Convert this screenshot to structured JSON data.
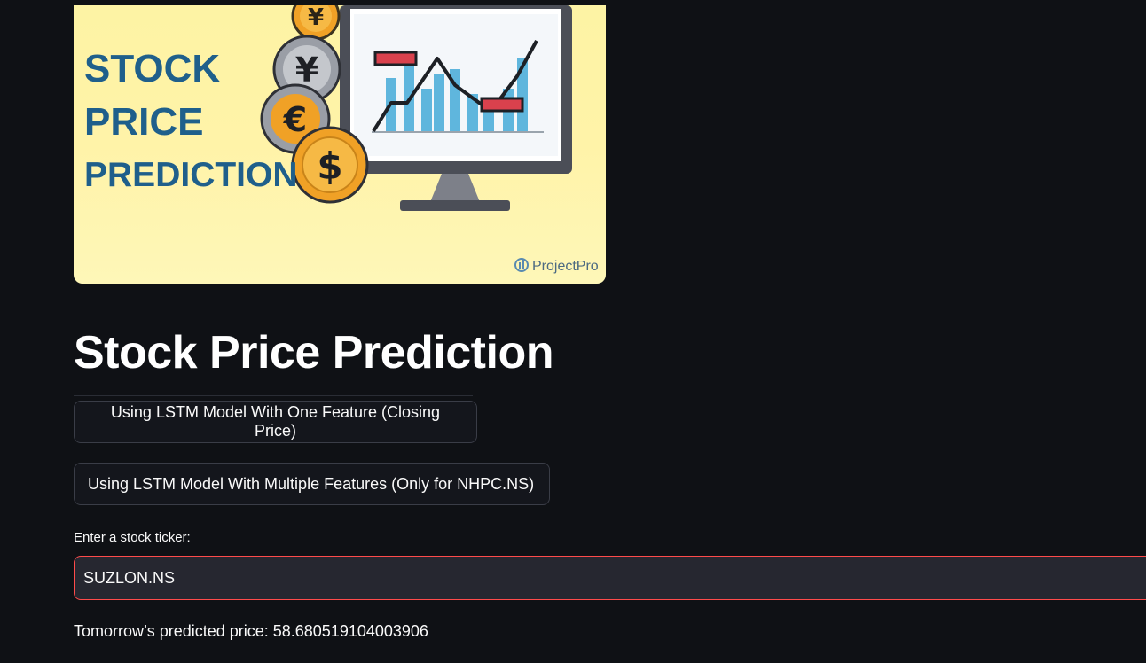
{
  "hero": {
    "headline_lines": [
      "STOCK",
      "PRICE",
      "PREDICTION"
    ],
    "watermark": "ProjectPro",
    "coin_symbols": [
      "¥",
      "€",
      "$"
    ],
    "colors": {
      "background": "#fdf3a4",
      "headline": "#1f5f8b",
      "coin_gold": "#f0a126",
      "coin_silver": "#9a9ea6",
      "monitor": "#4b4e57",
      "bars": "#5fb6dd",
      "marker": "#d9414d"
    }
  },
  "page": {
    "title": "Stock Price Prediction"
  },
  "buttons": {
    "one_feature": "Using LSTM Model With One Feature (Closing Price)",
    "multi_feature": "Using LSTM Model With Multiple Features (Only for NHPC.NS)"
  },
  "ticker": {
    "label": "Enter a stock ticker:",
    "value": "SUZLON.NS"
  },
  "result": {
    "text": "Tomorrow’s predicted price: 58.680519104003906"
  },
  "theme": {
    "background": "#0f1115",
    "input_background": "#262730",
    "input_focus_border": "#ff4b4b"
  }
}
